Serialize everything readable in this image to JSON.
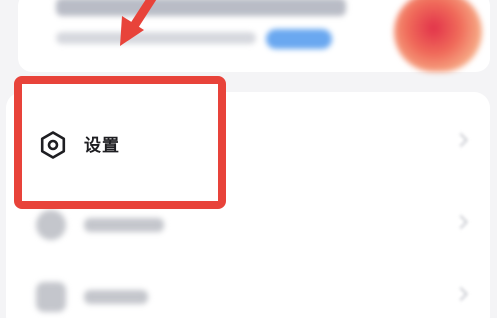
{
  "menu": {
    "settings_label": "设置",
    "settings_icon": "settings-hexagon-icon"
  },
  "colors": {
    "highlight": "#e8433a",
    "arrow": "#e8433a",
    "label_text": "#1e1e22"
  }
}
